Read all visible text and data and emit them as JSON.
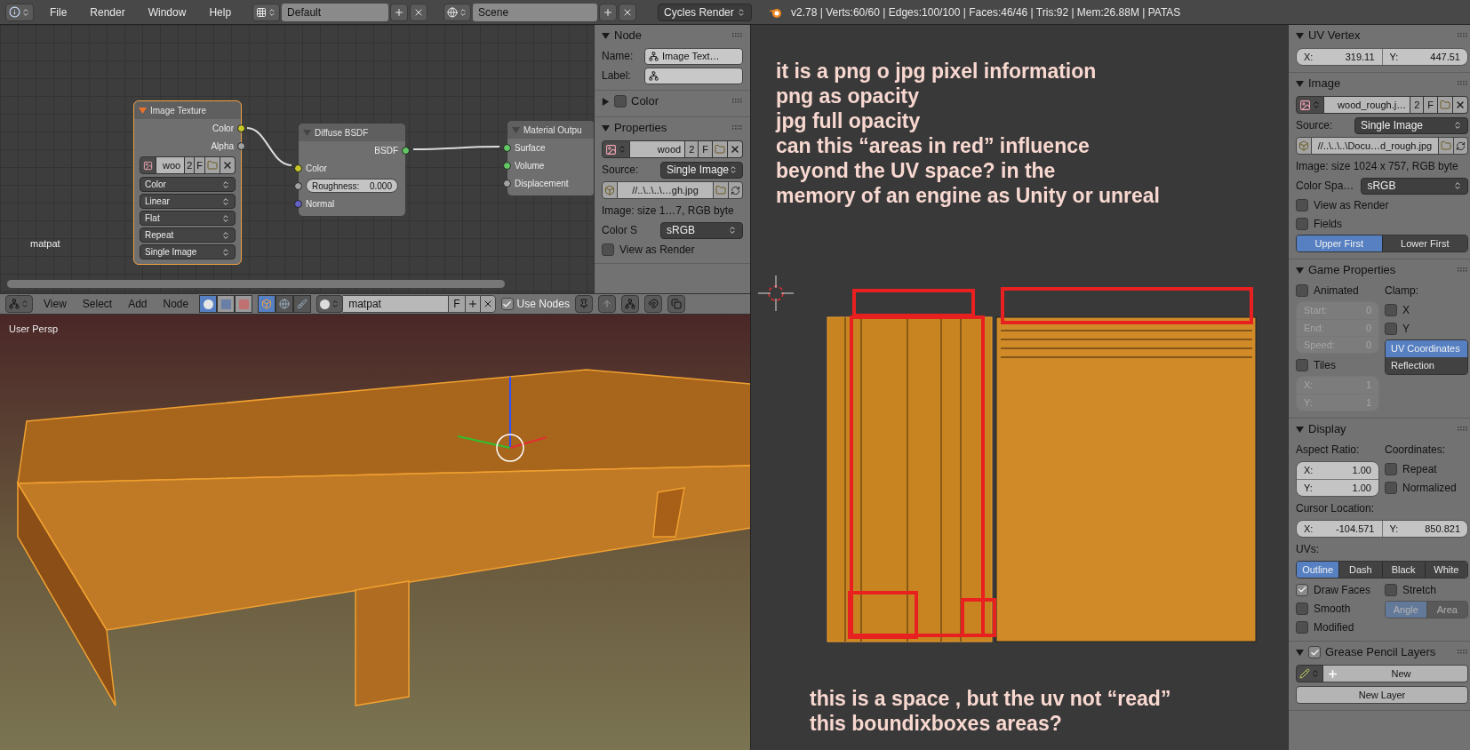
{
  "top_bar": {
    "menus": [
      "File",
      "Render",
      "Window",
      "Help"
    ],
    "screen_layout": "Default",
    "scene": "Scene",
    "render_engine": "Cycles Render",
    "stats": "v2.78 | Verts:60/60 | Edges:100/100 | Faces:46/46 | Tris:92 | Mem:26.88M | PATAS"
  },
  "node_editor": {
    "material_label": "matpat",
    "nodes": [
      {
        "title": "Image Texture",
        "selected": true,
        "rows": [
          {
            "kind": "output",
            "label": "Color",
            "color": "#c7c729"
          },
          {
            "kind": "output",
            "label": "Alpha",
            "color": "#a1a1a1"
          },
          {
            "kind": "image",
            "name": "woo",
            "users": "2",
            "fake": "F"
          },
          {
            "kind": "dropdown",
            "value": "Color"
          },
          {
            "kind": "dropdown",
            "value": "Linear"
          },
          {
            "kind": "dropdown",
            "value": "Flat"
          },
          {
            "kind": "dropdown",
            "value": "Repeat"
          },
          {
            "kind": "dropdown",
            "value": "Single Image"
          }
        ]
      },
      {
        "title": "Diffuse BSDF",
        "selected": false,
        "rows": [
          {
            "kind": "output",
            "label": "BSDF",
            "color": "#63c763"
          },
          {
            "kind": "input",
            "label": "Color",
            "color": "#c7c729"
          },
          {
            "kind": "slider",
            "label": "Roughness:",
            "value": "0.000",
            "color": "#a1a1a1"
          },
          {
            "kind": "input",
            "label": "Normal",
            "color": "#6363c7"
          }
        ]
      },
      {
        "title": "Material Outpu",
        "selected": false,
        "rows": [
          {
            "kind": "input",
            "label": "Surface",
            "color": "#63c763"
          },
          {
            "kind": "input",
            "label": "Volume",
            "color": "#63c763"
          },
          {
            "kind": "input",
            "label": "Displacement",
            "color": "#a1a1a1"
          }
        ]
      }
    ]
  },
  "node_panel": {
    "panels": [
      {
        "title": "Node",
        "expanded": true,
        "rows": [
          {
            "kind": "named_field",
            "label": "Name:",
            "value": "Image Text…"
          },
          {
            "kind": "named_field",
            "label": "Label:"
          }
        ]
      },
      {
        "title": "Color",
        "expanded": false,
        "checked": false
      },
      {
        "title": "Properties",
        "expanded": true,
        "rows": [
          {
            "kind": "image",
            "name": "wood",
            "users": "2",
            "fake": "F"
          },
          {
            "kind": "dropdown",
            "label": "Source:",
            "value": "Single Image"
          },
          {
            "kind": "file_path",
            "value": "//..\\..\\..\\…gh.jpg"
          },
          {
            "kind": "text",
            "text": "Image: size 1…7, RGB byte"
          },
          {
            "kind": "dropdown",
            "label": "Color S",
            "value": "sRGB"
          },
          {
            "kind": "checkbox",
            "label": "View as Render",
            "checked": false
          }
        ]
      }
    ]
  },
  "node_header": {
    "menus": [
      "View",
      "Select",
      "Add",
      "Node"
    ],
    "shader_types": [
      {
        "selected": true
      },
      {
        "selected": false
      },
      {
        "selected": false
      }
    ],
    "shader_objects": [
      {
        "selected": true
      },
      {
        "selected": false
      },
      {
        "selected": false
      }
    ],
    "material": "matpat",
    "fake": "F",
    "use_nodes": {
      "label": "Use Nodes",
      "checked": true
    }
  },
  "viewport": {
    "label": "User Persp"
  },
  "uv_editor": {
    "annotations": [
      "it is a png o jpg pixel information",
      "png as opacity",
      "jpg full opacity",
      "can this “areas in red” influence",
      "beyond the UV space? in the",
      "memory of an engine as Unity or unreal"
    ],
    "bottom_annotations": [
      "this is a space , but the uv not “read”",
      "this boundixboxes areas?"
    ]
  },
  "sidebar": {
    "panels": [
      {
        "title": "UV Vertex",
        "expanded": true,
        "rows": [
          {
            "kind": "pair_fields",
            "disabled": false,
            "fields": [
              {
                "label": "X:",
                "value": "319.11"
              },
              {
                "label": "Y:",
                "value": "447.51"
              }
            ]
          }
        ]
      },
      {
        "title": "Image",
        "expanded": true,
        "rows": [
          {
            "kind": "image",
            "name": "wood_rough.j…",
            "users": "2",
            "fake": "F"
          },
          {
            "kind": "dropdown",
            "label": "Source:",
            "value": "Single Image"
          },
          {
            "kind": "file_path",
            "value": "//..\\..\\..\\Docu…d_rough.jpg"
          },
          {
            "kind": "text",
            "text": "Image: size 1024 x 757, RGB byte"
          },
          {
            "kind": "dropdown",
            "label": "Color Spa…",
            "value": "sRGB"
          },
          {
            "kind": "checkbox",
            "label": "View as Render",
            "checked": false
          },
          {
            "kind": "checkbox",
            "label": "Fields",
            "checked": false
          },
          {
            "kind": "toggle_group",
            "disabled": false,
            "options": [
              {
                "label": "Upper First",
                "selected": true
              },
              {
                "label": "Lower First",
                "selected": false
              }
            ]
          }
        ]
      },
      {
        "title": "Game Properties",
        "expanded": true,
        "rows": [
          {
            "kind": "columns",
            "left": [
              {
                "kind": "checkbox",
                "label": "Animated",
                "checked": false
              },
              {
                "kind": "stack_fields",
                "disabled": true,
                "fields": [
                  {
                    "label": "Start:",
                    "value": "0"
                  },
                  {
                    "label": "End:",
                    "value": "0"
                  },
                  {
                    "label": "Speed:",
                    "value": "0"
                  }
                ]
              },
              {
                "kind": "checkbox",
                "label": "Tiles",
                "checked": false
              },
              {
                "kind": "stack_fields",
                "disabled": true,
                "fields": [
                  {
                    "label": "X:",
                    "value": "1"
                  },
                  {
                    "label": "Y:",
                    "value": "1"
                  }
                ]
              }
            ],
            "right": [
              {
                "kind": "text",
                "text": "Clamp:"
              },
              {
                "kind": "checkbox",
                "label": "X",
                "checked": false
              },
              {
                "kind": "checkbox",
                "label": "Y",
                "checked": false
              },
              {
                "kind": "toggle_stack",
                "options": [
                  {
                    "label": "UV Coordinates",
                    "selected": true
                  },
                  {
                    "label": "Reflection",
                    "selected": false
                  }
                ]
              }
            ]
          }
        ]
      },
      {
        "title": "Display",
        "expanded": true,
        "rows": [
          {
            "kind": "columns",
            "left": [
              {
                "kind": "text",
                "text": "Aspect Ratio:"
              },
              {
                "kind": "stack_fields",
                "disabled": false,
                "fields": [
                  {
                    "label": "X:",
                    "value": "1.00"
                  },
                  {
                    "label": "Y:",
                    "value": "1.00"
                  }
                ]
              }
            ],
            "right": [
              {
                "kind": "text",
                "text": "Coordinates:"
              },
              {
                "kind": "checkbox",
                "label": "Repeat",
                "checked": false
              },
              {
                "kind": "checkbox",
                "label": "Normalized",
                "checked": false
              }
            ]
          },
          {
            "kind": "text",
            "text": "Cursor Location:"
          },
          {
            "kind": "pair_fields",
            "disabled": false,
            "fields": [
              {
                "label": "X:",
                "value": "-104.571"
              },
              {
                "label": "Y:",
                "value": "850.821"
              }
            ]
          },
          {
            "kind": "text",
            "text": "UVs:"
          },
          {
            "kind": "toggle_group",
            "disabled": false,
            "options": [
              {
                "label": "Outline",
                "selected": true
              },
              {
                "label": "Dash",
                "selected": false
              },
              {
                "label": "Black",
                "selected": false
              },
              {
                "label": "White",
                "selected": false
              }
            ]
          },
          {
            "kind": "columns",
            "left": [
              {
                "kind": "checkbox",
                "label": "Draw Faces",
                "checked": true
              },
              {
                "kind": "checkbox",
                "label": "Smooth",
                "checked": false
              },
              {
                "kind": "checkbox",
                "label": "Modified",
                "checked": false
              }
            ],
            "right": [
              {
                "kind": "checkbox",
                "label": "Stretch",
                "checked": false
              },
              {
                "kind": "toggle_group",
                "disabled": true,
                "options": [
                  {
                    "label": "Angle",
                    "selected": true
                  },
                  {
                    "label": "Area",
                    "selected": false
                  }
                ]
              }
            ]
          }
        ]
      },
      {
        "title": "Grease Pencil Layers",
        "expanded": true,
        "checked": true,
        "rows": [
          {
            "kind": "new_button",
            "label": "New"
          },
          {
            "kind": "button",
            "label": "New Layer"
          }
        ]
      }
    ]
  }
}
